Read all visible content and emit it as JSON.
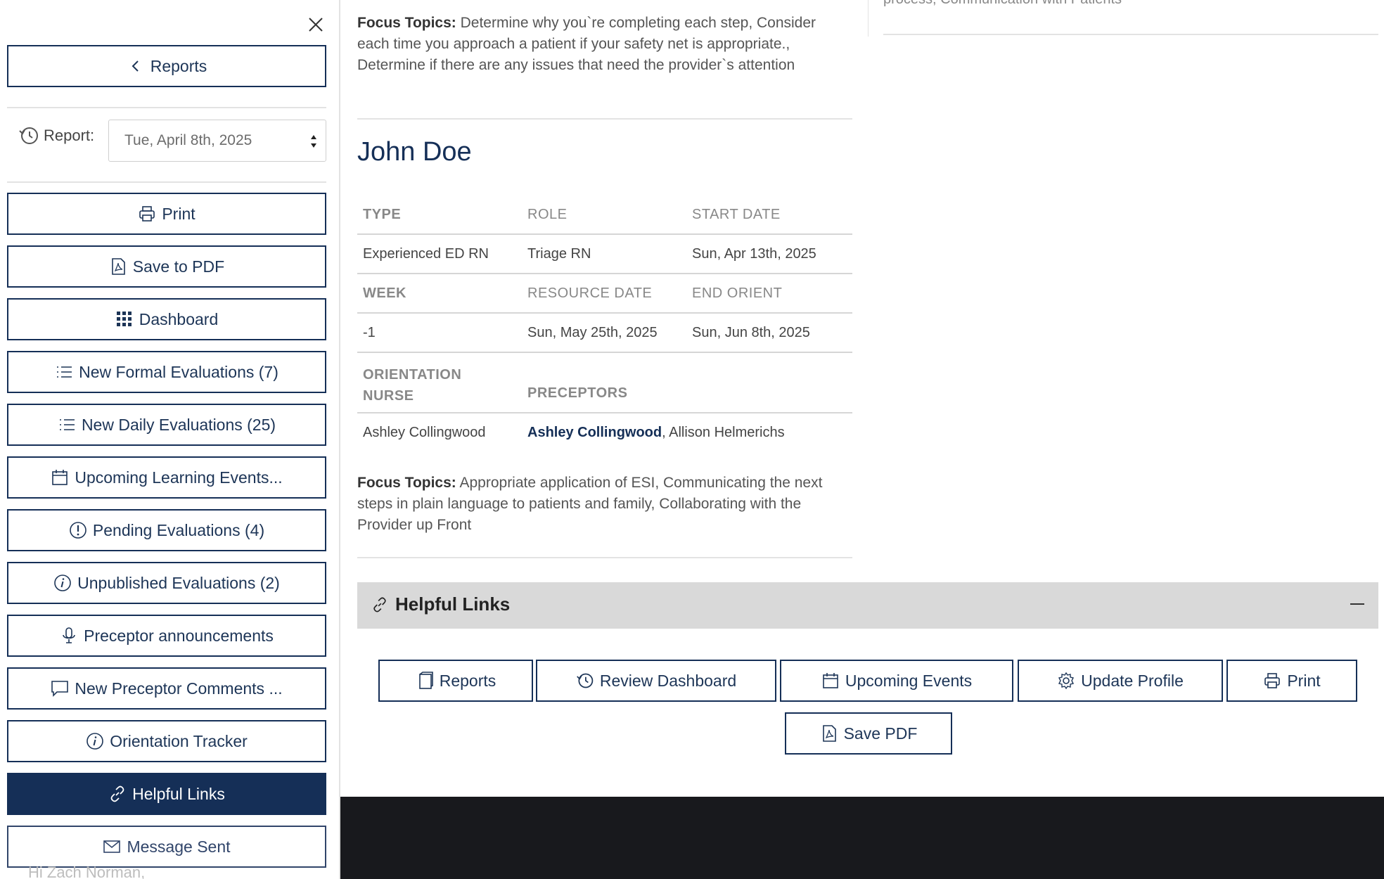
{
  "sidebar": {
    "back_label": "Reports",
    "report_label": "Report:",
    "report_value": "Tue, April 8th, 2025",
    "buttons": [
      {
        "label": "Print"
      },
      {
        "label": "Save to PDF"
      },
      {
        "label": "Dashboard"
      },
      {
        "label": "New Formal Evaluations (7)"
      },
      {
        "label": "New Daily Evaluations (25)"
      },
      {
        "label": "Upcoming Learning Events..."
      },
      {
        "label": "Pending Evaluations (4)"
      },
      {
        "label": "Unpublished Evaluations (2)"
      },
      {
        "label": "Preceptor announcements"
      },
      {
        "label": "New Preceptor Comments ..."
      },
      {
        "label": "Orientation Tracker"
      },
      {
        "label": "Helpful Links"
      },
      {
        "label": "Message Sent"
      }
    ]
  },
  "main": {
    "focus_top": {
      "label": "Focus Topics:",
      "text": " Determine why you`re completing each step, Consider each time you approach a patient if your safety net is appropriate., Determine if there are any issues that need the provider`s attention"
    },
    "right_column_partial": "process, Communication with Patients",
    "orientee": {
      "name": "John Doe",
      "h1": {
        "type": "TYPE",
        "role": "ROLE",
        "start": "START DATE"
      },
      "r1": {
        "type": "Experienced ED RN",
        "role": "Triage RN",
        "start": "Sun, Apr 13th, 2025"
      },
      "h2": {
        "week": "WEEK",
        "resource": "RESOURCE DATE",
        "end": "END ORIENT"
      },
      "r2": {
        "week": "-1",
        "resource": "Sun, May 25th, 2025",
        "end": "Sun, Jun 8th, 2025"
      },
      "h3": {
        "nurse_line1": "ORIENTATION",
        "nurse_line2": "NURSE",
        "preceptors": "PRECEPTORS"
      },
      "r3": {
        "nurse": "Ashley Collingwood",
        "preceptor_primary": "Ashley Collingwood",
        "preceptor_rest": ", Allison Helmerichs"
      },
      "focus": {
        "label": "Focus Topics:",
        "text": " Appropriate application of ESI, Communicating the next steps in plain language to patients and family, Collaborating with the Provider up Front"
      }
    }
  },
  "helpful_links": {
    "title": "Helpful Links",
    "buttons": [
      {
        "label": "Reports"
      },
      {
        "label": "Review Dashboard"
      },
      {
        "label": "Upcoming Events"
      },
      {
        "label": "Update Profile"
      },
      {
        "label": "Print"
      },
      {
        "label": "Save PDF"
      }
    ]
  },
  "footer": {
    "greeting": "Hi Zach Norman,"
  },
  "colors": {
    "primary": "#152f57",
    "footer_bg": "#18191d",
    "panel_head_bg": "#d9d9d9"
  }
}
